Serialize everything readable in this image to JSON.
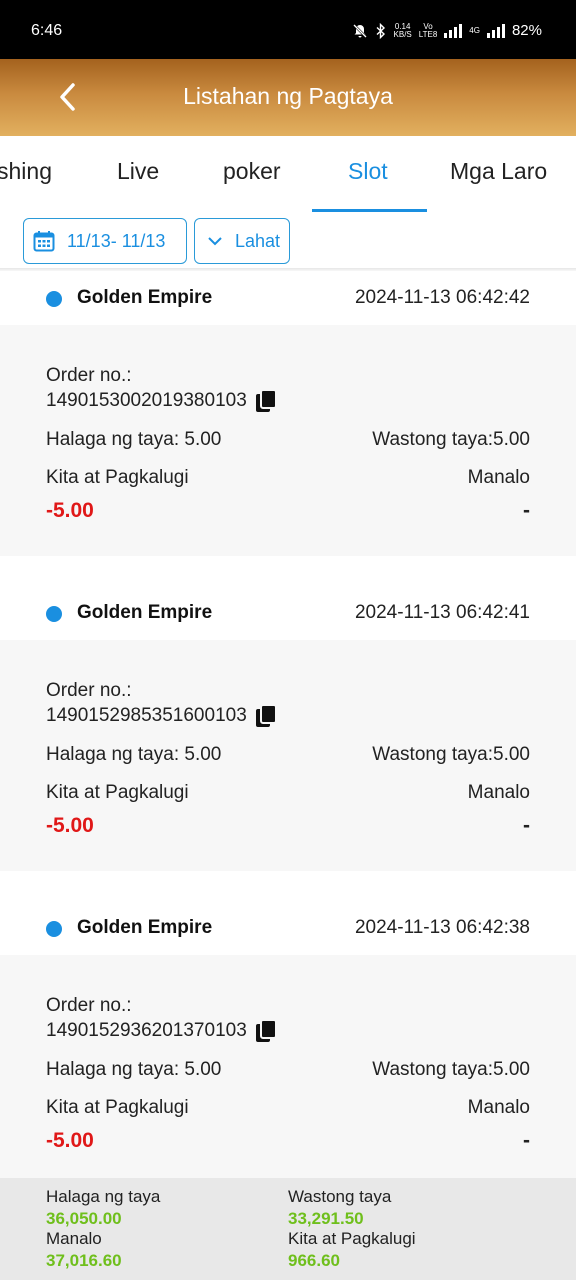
{
  "status_bar": {
    "time": "6:46",
    "net_speed_value": "0.14",
    "net_speed_unit": "KB/S",
    "volte_top": "Vo",
    "volte_bottom": "LTE8",
    "network_type": "4G",
    "battery": "82%"
  },
  "header": {
    "title": "Listahan ng Pagtaya"
  },
  "tabs": [
    {
      "label": "shing",
      "active": false
    },
    {
      "label": "Live",
      "active": false
    },
    {
      "label": "poker",
      "active": false
    },
    {
      "label": "Slot",
      "active": true
    },
    {
      "label": "Mga Laro",
      "active": false
    }
  ],
  "filters": {
    "date_range": "11/13- 11/13",
    "category": "Lahat"
  },
  "labels": {
    "order_no": "Order no.:",
    "bet_amount": "Halaga ng taya: 5.00",
    "valid_bet": "Wastong taya:5.00",
    "profit_loss": "Kita at Pagkalugi",
    "win": "Manalo"
  },
  "records": [
    {
      "game": "Golden Empire",
      "time": "2024-11-13 06:42:42",
      "order_no": "1490153002019380103",
      "profit_loss": "-5.00",
      "win": "-"
    },
    {
      "game": "Golden Empire",
      "time": "2024-11-13 06:42:41",
      "order_no": "1490152985351600103",
      "profit_loss": "-5.00",
      "win": "-"
    },
    {
      "game": "Golden Empire",
      "time": "2024-11-13 06:42:38",
      "order_no": "1490152936201370103",
      "profit_loss": "-5.00",
      "win": "-"
    }
  ],
  "summary": {
    "bet_amount_label": "Halaga ng taya",
    "bet_amount_value": "36,050.00",
    "valid_bet_label": "Wastong taya",
    "valid_bet_value": "33,291.50",
    "win_label": "Manalo",
    "win_value": "37,016.60",
    "profit_loss_label": "Kita at Pagkalugi",
    "profit_loss_value": "966.60"
  },
  "colors": {
    "accent": "#1a8fe0",
    "negative": "#e01818",
    "positive": "#6fbf1c",
    "header_gradient_top": "#a4621e",
    "header_gradient_bottom": "#e2b05f"
  }
}
